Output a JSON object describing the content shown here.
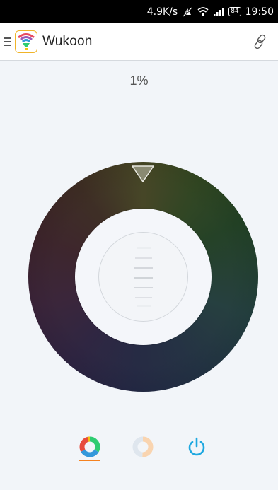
{
  "status_bar": {
    "net_speed": "4.9K/s",
    "battery": "84",
    "time": "19:50"
  },
  "header": {
    "title": "Wukoon",
    "menu_icon": "menu-icon",
    "logo": "wukoon-logo",
    "link_icon": "link-icon"
  },
  "brightness": {
    "label": "1%",
    "value": 1
  },
  "dial": {
    "selector_icon": "triangle-down-icon",
    "knob": "brightness-knob"
  },
  "bottom_nav": {
    "items": [
      {
        "name": "color-mode",
        "icon": "color-ring-icon",
        "active": true
      },
      {
        "name": "warm-white-mode",
        "icon": "warm-ring-icon",
        "active": false
      },
      {
        "name": "power",
        "icon": "power-icon",
        "active": false
      }
    ],
    "accent": "#f58220",
    "power_color": "#1fa8e0"
  }
}
